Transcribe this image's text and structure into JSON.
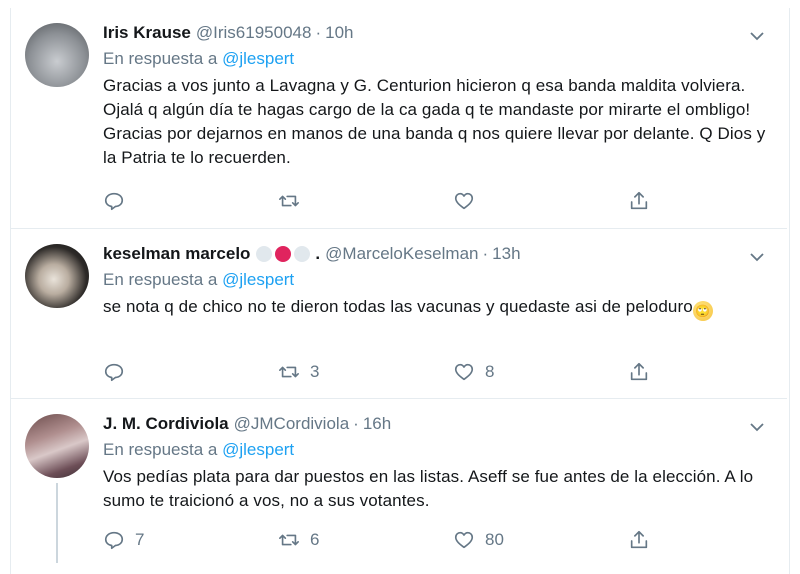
{
  "reply_prefix": "En respuesta a",
  "tweets": [
    {
      "name": "Iris Krause",
      "handle": "@Iris61950048",
      "separator": "·",
      "time": "10h",
      "reply_to": "@jlespert",
      "text": "Gracias a vos junto a Lavagna y G. Centurion hicieron q esa banda maldita volviera. Ojalá q algún día te hagas cargo de la ca gada q te mandaste por mirarte el ombligo! Gracias por dejarnos en manos de una banda q nos quiere llevar por delante. Q Dios y la Patria te lo recuerden.",
      "replies": "",
      "retweets": "",
      "likes": ""
    },
    {
      "name": "keselman marcelo",
      "name_suffix": ".",
      "handle": "@MarceloKeselman",
      "separator": "·",
      "time": "13h",
      "reply_to": "@jlespert",
      "text": "se nota q de chico no te dieron todas las vacunas y quedaste asi de peloduro",
      "emoji": "🙄",
      "replies": "",
      "retweets": "3",
      "likes": "8"
    },
    {
      "name": "J. M. Cordiviola",
      "handle": "@JMCordiviola",
      "separator": "·",
      "time": "16h",
      "reply_to": "@jlespert",
      "text": "Vos pedías plata para dar puestos en las listas. Aseff se fue antes de la elección.  A lo sumo te traicionó a vos, no a sus votantes.",
      "replies": "7",
      "retweets": "6",
      "likes": "80"
    }
  ]
}
